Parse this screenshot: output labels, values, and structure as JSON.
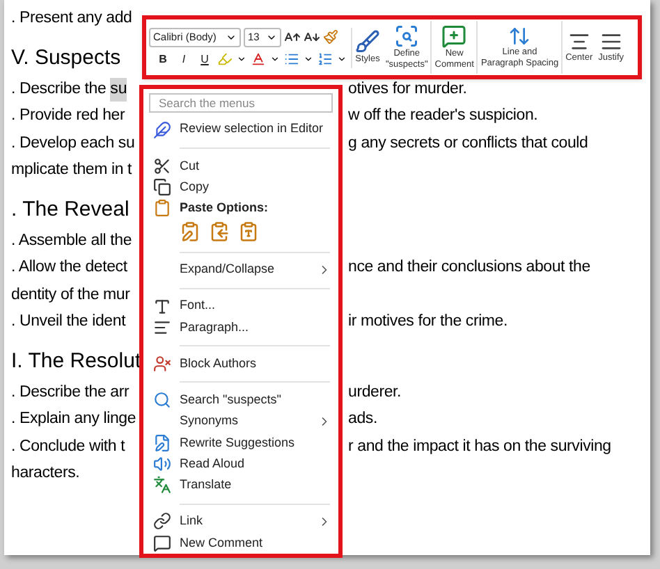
{
  "document": {
    "rows": [
      {
        "kind": "line",
        "left": ". Present any add"
      },
      {
        "kind": "heading",
        "left": "V. Suspects"
      },
      {
        "kind": "line",
        "left": ". Describe the ",
        "selected_text": "su",
        "right": "otives for murder."
      },
      {
        "kind": "line",
        "left": ". Provide red her",
        "right": "w off the reader's suspicion."
      },
      {
        "kind": "line",
        "left": ". Develop each su",
        "right": "g any secrets or conflicts that could"
      },
      {
        "kind": "line",
        "left": "mplicate them in t"
      },
      {
        "kind": "heading",
        "left": ". The Reveal"
      },
      {
        "kind": "line",
        "left": ". Assemble all the"
      },
      {
        "kind": "line",
        "left": ". Allow the detect",
        "right": "nce and their conclusions about the"
      },
      {
        "kind": "line",
        "left": "dentity of the mur"
      },
      {
        "kind": "line",
        "left": ". Unveil the ident",
        "right": "ir motives for the crime."
      },
      {
        "kind": "heading",
        "left": "I. The Resolut"
      },
      {
        "kind": "line",
        "left": ". Describe the arr",
        "right": "urderer."
      },
      {
        "kind": "line",
        "left": ". Explain any linge",
        "right": "ads."
      },
      {
        "kind": "line",
        "left": ". Conclude with t",
        "right": "r and the impact it has on the surviving"
      },
      {
        "kind": "line",
        "left": "haracters."
      }
    ]
  },
  "mini_toolbar": {
    "font": "Calibri (Body)",
    "size": "13",
    "format_buttons": [
      "B",
      "I",
      "U"
    ],
    "buttons": [
      {
        "lines": [
          "Styles"
        ]
      },
      {
        "lines": [
          "Define",
          "\"suspects\""
        ]
      },
      {
        "lines": [
          "New",
          "Comment"
        ]
      },
      {
        "lines": [
          "Line and",
          "Paragraph Spacing"
        ]
      },
      {
        "lines": [
          "Center"
        ]
      },
      {
        "lines": [
          "Justify"
        ]
      }
    ]
  },
  "context_menu": {
    "search": {
      "placeholder": "Search the menus"
    },
    "items": [
      {
        "kind": "action",
        "label": "Review selection in Editor"
      },
      {
        "kind": "divider"
      },
      {
        "kind": "action",
        "label": "Cut"
      },
      {
        "kind": "action",
        "label": "Copy"
      },
      {
        "kind": "header",
        "label": "Paste Options:"
      },
      {
        "kind": "paste"
      },
      {
        "kind": "divider"
      },
      {
        "kind": "submenu",
        "label": "Expand/Collapse"
      },
      {
        "kind": "divider"
      },
      {
        "kind": "action",
        "label": "Font..."
      },
      {
        "kind": "action",
        "label": "Paragraph..."
      },
      {
        "kind": "divider"
      },
      {
        "kind": "action",
        "label": "Block Authors"
      },
      {
        "kind": "divider"
      },
      {
        "kind": "action",
        "label": "Search \"suspects\""
      },
      {
        "kind": "submenu",
        "label": "Synonyms"
      },
      {
        "kind": "action",
        "label": "Rewrite Suggestions"
      },
      {
        "kind": "action",
        "label": "Read Aloud"
      },
      {
        "kind": "action",
        "label": "Translate"
      },
      {
        "kind": "divider"
      },
      {
        "kind": "submenu",
        "label": "Link"
      },
      {
        "kind": "action",
        "label": "New Comment"
      }
    ]
  }
}
